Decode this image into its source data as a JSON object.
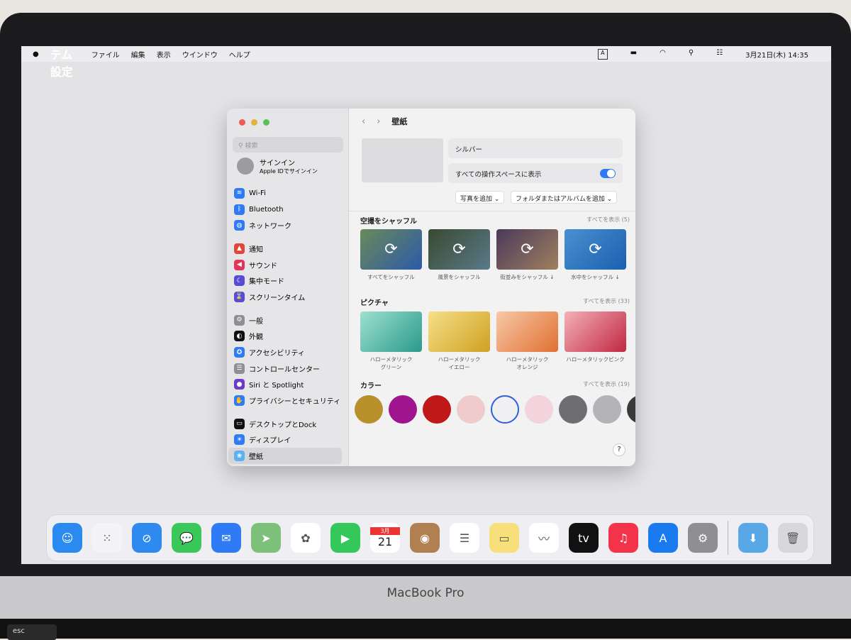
{
  "menubar": {
    "app": "システム設定",
    "items": [
      "ファイル",
      "編集",
      "表示",
      "ウインドウ",
      "ヘルプ"
    ],
    "input": "A",
    "datetime": "3月21日(木) 14:35"
  },
  "sidebar": {
    "search_placeholder": "検索",
    "signin_title": "サインイン",
    "signin_sub": "Apple IDでサインイン",
    "items": [
      {
        "label": "Wi-Fi",
        "icon": "wifi-icon",
        "color": "#2f7bf6",
        "glyph": "≋"
      },
      {
        "label": "Bluetooth",
        "icon": "bluetooth-icon",
        "color": "#2f7bf6",
        "glyph": "ᛒ"
      },
      {
        "label": "ネットワーク",
        "icon": "globe-icon",
        "color": "#2f7bf6",
        "glyph": "◍"
      },
      {
        "label": "通知",
        "icon": "bell-icon",
        "color": "#e2453c",
        "glyph": "▲"
      },
      {
        "label": "サウンド",
        "icon": "speaker-icon",
        "color": "#e2345a",
        "glyph": "◀"
      },
      {
        "label": "集中モード",
        "icon": "moon-icon",
        "color": "#5a4bd6",
        "glyph": "☾"
      },
      {
        "label": "スクリーンタイム",
        "icon": "hourglass-icon",
        "color": "#5a4bd6",
        "glyph": "⌛"
      },
      {
        "label": "一般",
        "icon": "gear-icon",
        "color": "#8e8e93",
        "glyph": "⚙"
      },
      {
        "label": "外観",
        "icon": "appearance-icon",
        "color": "#111111",
        "glyph": "◐"
      },
      {
        "label": "アクセシビリティ",
        "icon": "accessibility-icon",
        "color": "#2f7bf6",
        "glyph": "✪"
      },
      {
        "label": "コントロールセンター",
        "icon": "control-center-icon",
        "color": "#8e8e93",
        "glyph": "☰"
      },
      {
        "label": "Siri と Spotlight",
        "icon": "siri-icon",
        "color": "#6a3cc8",
        "glyph": "●"
      },
      {
        "label": "プライバシーとセキュリティ",
        "icon": "hand-icon",
        "color": "#2f7bf6",
        "glyph": "✋"
      },
      {
        "label": "デスクトップとDock",
        "icon": "dock-icon",
        "color": "#111111",
        "glyph": "▭"
      },
      {
        "label": "ディスプレイ",
        "icon": "sun-icon",
        "color": "#2f7bf6",
        "glyph": "☀"
      },
      {
        "label": "壁紙",
        "icon": "wallpaper-icon",
        "color": "#5ab0f0",
        "glyph": "❀"
      }
    ]
  },
  "main": {
    "title": "壁紙",
    "wallpaper_name": "シルバー",
    "show_all_spaces": "すべての操作スペースに表示",
    "show_all_spaces_on": true,
    "add_photo": "写真を追加 ⌄",
    "add_folder": "フォルダまたはアルバムを追加 ⌄",
    "aerial": {
      "title": "空撮をシャッフル",
      "show_all": "すべてを表示 (5)",
      "items": [
        "すべてをシャッフル",
        "風景をシャッフル",
        "街並みをシャッフル ↓",
        "水中をシャッフル ↓"
      ]
    },
    "pictures": {
      "title": "ピクチャ",
      "show_all": "すべてを表示 (33)",
      "items": [
        "ハローメタリック\nグリーン",
        "ハローメタリック\nイエロー",
        "ハローメタリック\nオレンジ",
        "ハローメタリックピンク"
      ]
    },
    "colors": {
      "title": "カラー",
      "show_all": "すべてを表示 (19)",
      "swatches": [
        "#b8902c",
        "#a0158e",
        "#c01818",
        "#efcccb",
        "#f0f0f2",
        "#f3d3dc",
        "#6e6e72",
        "#b4b4b8",
        "#3a3a3a"
      ],
      "selected": 4
    },
    "help": "?"
  },
  "dock": [
    "Finder",
    "Launchpad",
    "Safari",
    "メッセージ",
    "メール",
    "マップ",
    "写真",
    "FaceTime",
    "カレンダー",
    "連絡先",
    "リマインダー",
    "メモ",
    "フリーボード",
    "TV",
    "ミュージック",
    "App Store",
    "システム設定",
    "ダウンロード",
    "ゴミ箱"
  ],
  "calendar": {
    "month": "3月",
    "day": "21"
  },
  "brand": "MacBook Pro",
  "esc": "esc"
}
